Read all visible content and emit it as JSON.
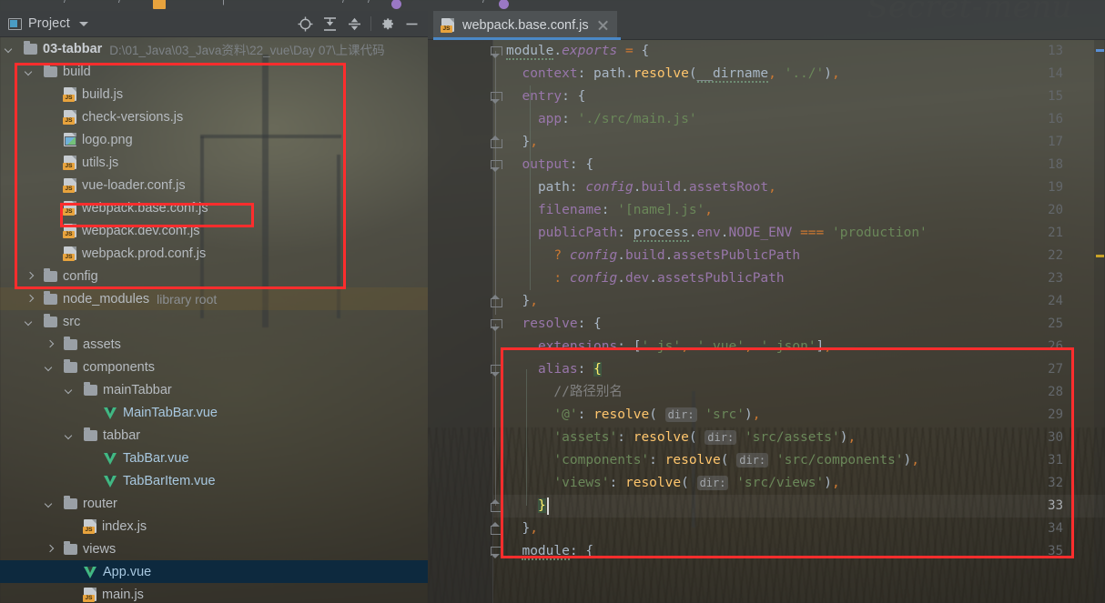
{
  "window": {
    "background_watermark": "Secret-menu",
    "accent_color": "#4a88c7"
  },
  "project_panel": {
    "title": "Project",
    "icons": [
      {
        "name": "locate-icon",
        "glyph": "crosshair"
      },
      {
        "name": "expand-all-icon",
        "glyph": "expand"
      },
      {
        "name": "collapse-all-icon",
        "glyph": "collapse"
      },
      {
        "name": "settings-gear-icon",
        "glyph": "gear"
      },
      {
        "name": "hide-panel-icon",
        "glyph": "minus"
      }
    ],
    "root": {
      "name": "03-tabbar",
      "path": "D:\\01_Java\\03_Java资料\\22_vue\\Day 07\\上课代码"
    },
    "tree": [
      {
        "label": "build",
        "icon": "folder",
        "depth": 1,
        "arrow": "down"
      },
      {
        "label": "build.js",
        "icon": "js",
        "depth": 2,
        "arrow": "none"
      },
      {
        "label": "check-versions.js",
        "icon": "js",
        "depth": 2,
        "arrow": "none"
      },
      {
        "label": "logo.png",
        "icon": "png",
        "depth": 2,
        "arrow": "none"
      },
      {
        "label": "utils.js",
        "icon": "js",
        "depth": 2,
        "arrow": "none"
      },
      {
        "label": "vue-loader.conf.js",
        "icon": "js",
        "depth": 2,
        "arrow": "none"
      },
      {
        "label": "webpack.base.conf.js",
        "icon": "js",
        "depth": 2,
        "arrow": "none",
        "highlighted": true
      },
      {
        "label": "webpack.dev.conf.js",
        "icon": "js",
        "depth": 2,
        "arrow": "none"
      },
      {
        "label": "webpack.prod.conf.js",
        "icon": "js",
        "depth": 2,
        "arrow": "none"
      },
      {
        "label": "config",
        "icon": "folder",
        "depth": 1,
        "arrow": "right"
      },
      {
        "label": "node_modules",
        "icon": "folder",
        "depth": 1,
        "arrow": "right",
        "note": "library root",
        "libroot": true
      },
      {
        "label": "src",
        "icon": "folder",
        "depth": 1,
        "arrow": "down"
      },
      {
        "label": "assets",
        "icon": "folder",
        "depth": 2,
        "arrow": "right"
      },
      {
        "label": "components",
        "icon": "folder",
        "depth": 2,
        "arrow": "down"
      },
      {
        "label": "mainTabbar",
        "icon": "folder",
        "depth": 3,
        "arrow": "down"
      },
      {
        "label": "MainTabBar.vue",
        "icon": "vue",
        "depth": 4,
        "arrow": "none"
      },
      {
        "label": "tabbar",
        "icon": "folder",
        "depth": 3,
        "arrow": "down"
      },
      {
        "label": "TabBar.vue",
        "icon": "vue",
        "depth": 4,
        "arrow": "none"
      },
      {
        "label": "TabBarItem.vue",
        "icon": "vue",
        "depth": 4,
        "arrow": "none"
      },
      {
        "label": "router",
        "icon": "folder",
        "depth": 2,
        "arrow": "down"
      },
      {
        "label": "index.js",
        "icon": "js",
        "depth": 3,
        "arrow": "none"
      },
      {
        "label": "views",
        "icon": "folder",
        "depth": 2,
        "arrow": "right"
      },
      {
        "label": "App.vue",
        "icon": "vue",
        "depth": 3,
        "arrow": "none",
        "selected": true
      },
      {
        "label": "main.js",
        "icon": "js",
        "depth": 3,
        "arrow": "none"
      }
    ]
  },
  "editor": {
    "tab": {
      "label": "webpack.base.conf.js",
      "icon": "js-file-icon",
      "close_label": "×"
    },
    "current_line": 33,
    "lines": [
      {
        "num": 13,
        "text": "module.exports = {"
      },
      {
        "num": 14,
        "text": "  context: path.resolve(__dirname, '../'),"
      },
      {
        "num": 15,
        "text": "  entry: {"
      },
      {
        "num": 16,
        "text": "    app: './src/main.js'"
      },
      {
        "num": 17,
        "text": "  },"
      },
      {
        "num": 18,
        "text": "  output: {"
      },
      {
        "num": 19,
        "text": "    path: config.build.assetsRoot,"
      },
      {
        "num": 20,
        "text": "    filename: '[name].js',"
      },
      {
        "num": 21,
        "text": "    publicPath: process.env.NODE_ENV === 'production'"
      },
      {
        "num": 22,
        "text": "      ? config.build.assetsPublicPath"
      },
      {
        "num": 23,
        "text": "      : config.dev.assetsPublicPath"
      },
      {
        "num": 24,
        "text": "  },"
      },
      {
        "num": 25,
        "text": "  resolve: {"
      },
      {
        "num": 26,
        "text": "    extensions: ['.js', '.vue', '.json'],"
      },
      {
        "num": 27,
        "text": "    alias: {"
      },
      {
        "num": 28,
        "text": "      //路径别名"
      },
      {
        "num": 29,
        "text": "      '@': resolve( dir: 'src'),"
      },
      {
        "num": 30,
        "text": "      'assets': resolve( dir: 'src/assets'),"
      },
      {
        "num": 31,
        "text": "      'components': resolve( dir: 'src/components'),"
      },
      {
        "num": 32,
        "text": "      'views': resolve( dir: 'src/views'),"
      },
      {
        "num": 33,
        "text": "    }"
      },
      {
        "num": 34,
        "text": "  },"
      },
      {
        "num": 35,
        "text": "  module: {"
      }
    ],
    "inlay_hint": "dir:"
  },
  "annotations": {
    "color": "#ff2d2d",
    "boxes": [
      {
        "name": "build-folder-highlight-box"
      },
      {
        "name": "webpack-base-conf-file-highlight-box"
      },
      {
        "name": "alias-block-highlight-box"
      }
    ]
  }
}
